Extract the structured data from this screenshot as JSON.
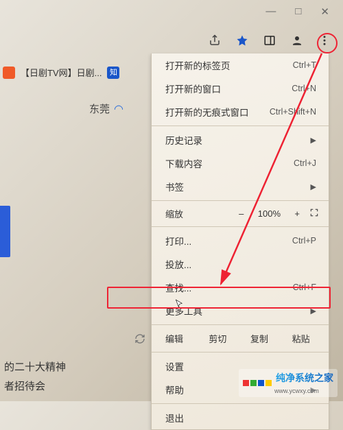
{
  "window_controls": {
    "min": "—",
    "max": "□",
    "close": "✕"
  },
  "toolbar": {
    "share_icon": "share-icon",
    "star_icon": "star-icon",
    "panel_icon": "panel-icon",
    "profile_icon": "profile-icon",
    "kebab_icon": "kebab-icon"
  },
  "tab": {
    "title": "【日剧TV网】日剧...",
    "icon2_text": "知"
  },
  "left": {
    "city": "东莞",
    "line1": "的二十大精神",
    "line2": "者招待会"
  },
  "menu": {
    "new_tab": {
      "label": "打开新的标签页",
      "shortcut": "Ctrl+T"
    },
    "new_window": {
      "label": "打开新的窗口",
      "shortcut": "Ctrl+N"
    },
    "incognito": {
      "label": "打开新的无痕式窗口",
      "shortcut": "Ctrl+Shift+N"
    },
    "history": {
      "label": "历史记录"
    },
    "downloads": {
      "label": "下载内容",
      "shortcut": "Ctrl+J"
    },
    "bookmarks": {
      "label": "书签"
    },
    "zoom": {
      "label": "缩放",
      "minus": "–",
      "pct": "100%",
      "plus": "+"
    },
    "print": {
      "label": "打印...",
      "shortcut": "Ctrl+P"
    },
    "cast": {
      "label": "投放..."
    },
    "find": {
      "label": "查找...",
      "shortcut": "Ctrl+F"
    },
    "more_tools": {
      "label": "更多工具"
    },
    "edit": {
      "label": "编辑",
      "cut": "剪切",
      "copy": "复制",
      "paste": "粘贴"
    },
    "settings": {
      "label": "设置"
    },
    "help": {
      "label": "帮助"
    },
    "exit": {
      "label": "退出"
    }
  },
  "watermark": {
    "text": "纯净系统之家",
    "url": "www.ycwxy.com"
  }
}
